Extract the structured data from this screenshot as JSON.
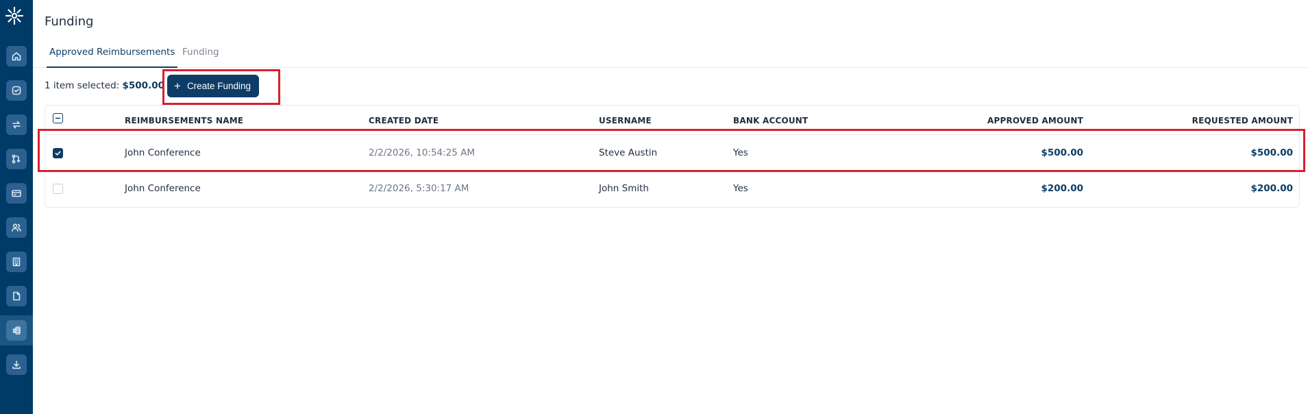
{
  "header": {
    "title": "Funding"
  },
  "tabs": [
    {
      "label": "Approved Reimbursements",
      "active": true
    },
    {
      "label": "Funding",
      "active": false
    }
  ],
  "toolbar": {
    "selection_prefix": "1 item selected: ",
    "selection_amount": "$500.00",
    "create_label": "Create Funding"
  },
  "table": {
    "columns": [
      "REIMBURSEMENTS NAME",
      "CREATED DATE",
      "USERNAME",
      "BANK ACCOUNT",
      "APPROVED AMOUNT",
      "REQUESTED AMOUNT"
    ],
    "rows": [
      {
        "selected": true,
        "name": "John Conference",
        "created": "2/2/2026, 10:54:25 AM",
        "username": "Steve Austin",
        "bank": "Yes",
        "approved": "$500.00",
        "requested": "$500.00"
      },
      {
        "selected": false,
        "name": "John Conference",
        "created": "2/2/2026, 5:30:17 AM",
        "username": "John Smith",
        "bank": "Yes",
        "approved": "$200.00",
        "requested": "$200.00"
      }
    ]
  },
  "sidebar": {
    "items": [
      {
        "icon": "home-icon"
      },
      {
        "icon": "check-circle-icon"
      },
      {
        "icon": "transfer-icon"
      },
      {
        "icon": "workflow-icon"
      },
      {
        "icon": "card-icon"
      },
      {
        "icon": "users-icon"
      },
      {
        "icon": "building-icon"
      },
      {
        "icon": "document-icon"
      },
      {
        "icon": "funding-icon",
        "active": true
      },
      {
        "icon": "download-icon"
      }
    ]
  },
  "colors": {
    "sidebar": "#003a66",
    "primary": "#0d3d66",
    "highlight": "#d6202f"
  }
}
